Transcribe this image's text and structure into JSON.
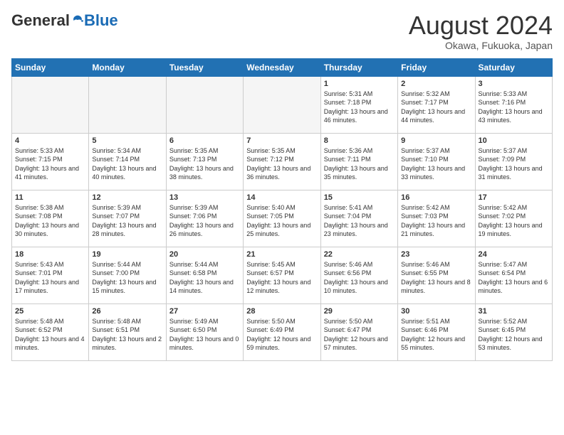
{
  "header": {
    "logo_general": "General",
    "logo_blue": "Blue",
    "month_year": "August 2024",
    "location": "Okawa, Fukuoka, Japan"
  },
  "calendar": {
    "weekdays": [
      "Sunday",
      "Monday",
      "Tuesday",
      "Wednesday",
      "Thursday",
      "Friday",
      "Saturday"
    ],
    "weeks": [
      [
        {
          "day": "",
          "sunrise": "",
          "sunset": "",
          "daylight": "",
          "empty": true
        },
        {
          "day": "",
          "sunrise": "",
          "sunset": "",
          "daylight": "",
          "empty": true
        },
        {
          "day": "",
          "sunrise": "",
          "sunset": "",
          "daylight": "",
          "empty": true
        },
        {
          "day": "",
          "sunrise": "",
          "sunset": "",
          "daylight": "",
          "empty": true
        },
        {
          "day": "1",
          "sunrise": "5:31 AM",
          "sunset": "7:18 PM",
          "daylight": "13 hours and 46 minutes."
        },
        {
          "day": "2",
          "sunrise": "5:32 AM",
          "sunset": "7:17 PM",
          "daylight": "13 hours and 44 minutes."
        },
        {
          "day": "3",
          "sunrise": "5:33 AM",
          "sunset": "7:16 PM",
          "daylight": "13 hours and 43 minutes."
        }
      ],
      [
        {
          "day": "4",
          "sunrise": "5:33 AM",
          "sunset": "7:15 PM",
          "daylight": "13 hours and 41 minutes."
        },
        {
          "day": "5",
          "sunrise": "5:34 AM",
          "sunset": "7:14 PM",
          "daylight": "13 hours and 40 minutes."
        },
        {
          "day": "6",
          "sunrise": "5:35 AM",
          "sunset": "7:13 PM",
          "daylight": "13 hours and 38 minutes."
        },
        {
          "day": "7",
          "sunrise": "5:35 AM",
          "sunset": "7:12 PM",
          "daylight": "13 hours and 36 minutes."
        },
        {
          "day": "8",
          "sunrise": "5:36 AM",
          "sunset": "7:11 PM",
          "daylight": "13 hours and 35 minutes."
        },
        {
          "day": "9",
          "sunrise": "5:37 AM",
          "sunset": "7:10 PM",
          "daylight": "13 hours and 33 minutes."
        },
        {
          "day": "10",
          "sunrise": "5:37 AM",
          "sunset": "7:09 PM",
          "daylight": "13 hours and 31 minutes."
        }
      ],
      [
        {
          "day": "11",
          "sunrise": "5:38 AM",
          "sunset": "7:08 PM",
          "daylight": "13 hours and 30 minutes."
        },
        {
          "day": "12",
          "sunrise": "5:39 AM",
          "sunset": "7:07 PM",
          "daylight": "13 hours and 28 minutes."
        },
        {
          "day": "13",
          "sunrise": "5:39 AM",
          "sunset": "7:06 PM",
          "daylight": "13 hours and 26 minutes."
        },
        {
          "day": "14",
          "sunrise": "5:40 AM",
          "sunset": "7:05 PM",
          "daylight": "13 hours and 25 minutes."
        },
        {
          "day": "15",
          "sunrise": "5:41 AM",
          "sunset": "7:04 PM",
          "daylight": "13 hours and 23 minutes."
        },
        {
          "day": "16",
          "sunrise": "5:42 AM",
          "sunset": "7:03 PM",
          "daylight": "13 hours and 21 minutes."
        },
        {
          "day": "17",
          "sunrise": "5:42 AM",
          "sunset": "7:02 PM",
          "daylight": "13 hours and 19 minutes."
        }
      ],
      [
        {
          "day": "18",
          "sunrise": "5:43 AM",
          "sunset": "7:01 PM",
          "daylight": "13 hours and 17 minutes."
        },
        {
          "day": "19",
          "sunrise": "5:44 AM",
          "sunset": "7:00 PM",
          "daylight": "13 hours and 15 minutes."
        },
        {
          "day": "20",
          "sunrise": "5:44 AM",
          "sunset": "6:58 PM",
          "daylight": "13 hours and 14 minutes."
        },
        {
          "day": "21",
          "sunrise": "5:45 AM",
          "sunset": "6:57 PM",
          "daylight": "13 hours and 12 minutes."
        },
        {
          "day": "22",
          "sunrise": "5:46 AM",
          "sunset": "6:56 PM",
          "daylight": "13 hours and 10 minutes."
        },
        {
          "day": "23",
          "sunrise": "5:46 AM",
          "sunset": "6:55 PM",
          "daylight": "13 hours and 8 minutes."
        },
        {
          "day": "24",
          "sunrise": "5:47 AM",
          "sunset": "6:54 PM",
          "daylight": "13 hours and 6 minutes."
        }
      ],
      [
        {
          "day": "25",
          "sunrise": "5:48 AM",
          "sunset": "6:52 PM",
          "daylight": "13 hours and 4 minutes."
        },
        {
          "day": "26",
          "sunrise": "5:48 AM",
          "sunset": "6:51 PM",
          "daylight": "13 hours and 2 minutes."
        },
        {
          "day": "27",
          "sunrise": "5:49 AM",
          "sunset": "6:50 PM",
          "daylight": "13 hours and 0 minutes."
        },
        {
          "day": "28",
          "sunrise": "5:50 AM",
          "sunset": "6:49 PM",
          "daylight": "12 hours and 59 minutes."
        },
        {
          "day": "29",
          "sunrise": "5:50 AM",
          "sunset": "6:47 PM",
          "daylight": "12 hours and 57 minutes."
        },
        {
          "day": "30",
          "sunrise": "5:51 AM",
          "sunset": "6:46 PM",
          "daylight": "12 hours and 55 minutes."
        },
        {
          "day": "31",
          "sunrise": "5:52 AM",
          "sunset": "6:45 PM",
          "daylight": "12 hours and 53 minutes."
        }
      ]
    ]
  }
}
